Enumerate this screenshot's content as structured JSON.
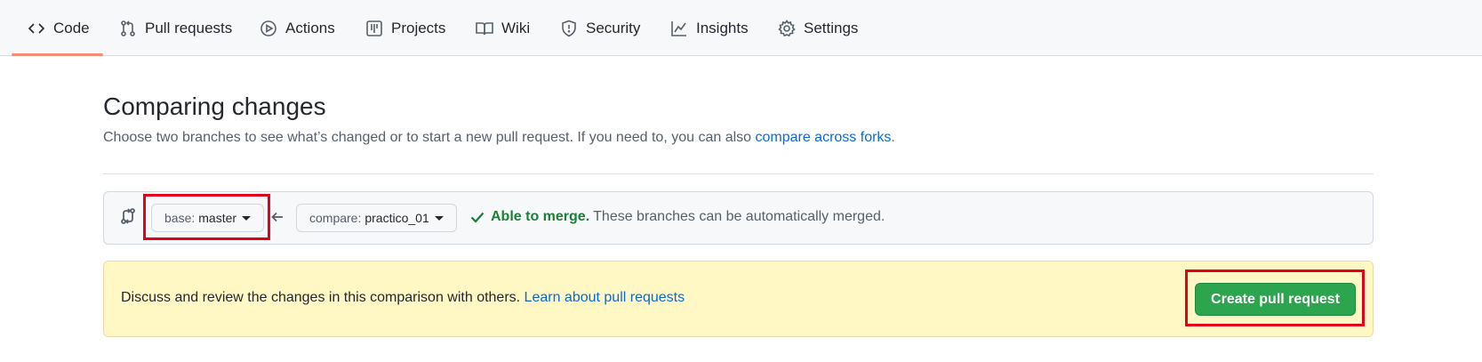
{
  "tabs": [
    {
      "label": "Code",
      "icon": "code-icon"
    },
    {
      "label": "Pull requests",
      "icon": "git-pull-request-icon"
    },
    {
      "label": "Actions",
      "icon": "play-icon"
    },
    {
      "label": "Projects",
      "icon": "table-icon"
    },
    {
      "label": "Wiki",
      "icon": "book-icon"
    },
    {
      "label": "Security",
      "icon": "shield-icon"
    },
    {
      "label": "Insights",
      "icon": "graph-icon"
    },
    {
      "label": "Settings",
      "icon": "gear-icon"
    }
  ],
  "selected_tab": "Code",
  "compare": {
    "title": "Comparing changes",
    "subtitle_text": "Choose two branches to see what’s changed or to start a new pull request. If you need to, you can also ",
    "subtitle_link": "compare across forks",
    "subtitle_end": ".",
    "base_prefix": "base:",
    "base_branch": "master",
    "compare_prefix": "compare:",
    "compare_branch": "practico_01",
    "merge_ok": "Able to merge.",
    "merge_detail": "These branches can be automatically merged."
  },
  "flash": {
    "text": "Discuss and review the changes in this comparison with others. ",
    "link": "Learn about pull requests",
    "button": "Create pull request"
  },
  "colors": {
    "accent_underline": "#fd8c73",
    "link": "#0969da",
    "success": "#1a7f37",
    "primary_button": "#2da44e",
    "flash_bg": "#fff8c5",
    "highlight": "#e3001b"
  }
}
